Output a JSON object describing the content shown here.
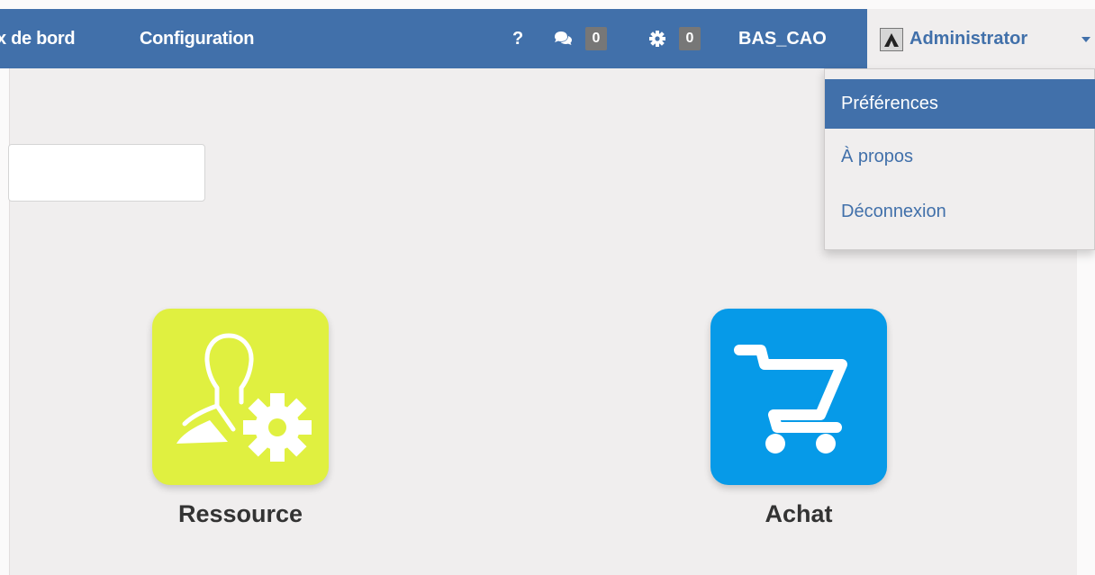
{
  "topbar": {
    "menu_items": [
      {
        "label": "x de bord"
      },
      {
        "label": "Configuration"
      }
    ],
    "help_label": "?",
    "messages_count": "0",
    "activities_count": "0",
    "database_name": "BAS_CAO",
    "user": {
      "name": "Administrator"
    }
  },
  "user_menu": {
    "items": [
      {
        "label": "Préférences",
        "active": true
      },
      {
        "label": "À propos"
      },
      {
        "label": "Déconnexion"
      }
    ]
  },
  "apps": [
    {
      "label": "Ressource",
      "icon": "user-gear-icon",
      "color": "#e0f040"
    },
    {
      "label": "Achat",
      "icon": "shopping-cart-icon",
      "color": "#069ae8"
    }
  ],
  "colors": {
    "navbar": "#4170aa",
    "badge": "#777777",
    "background": "#f0eeee"
  }
}
